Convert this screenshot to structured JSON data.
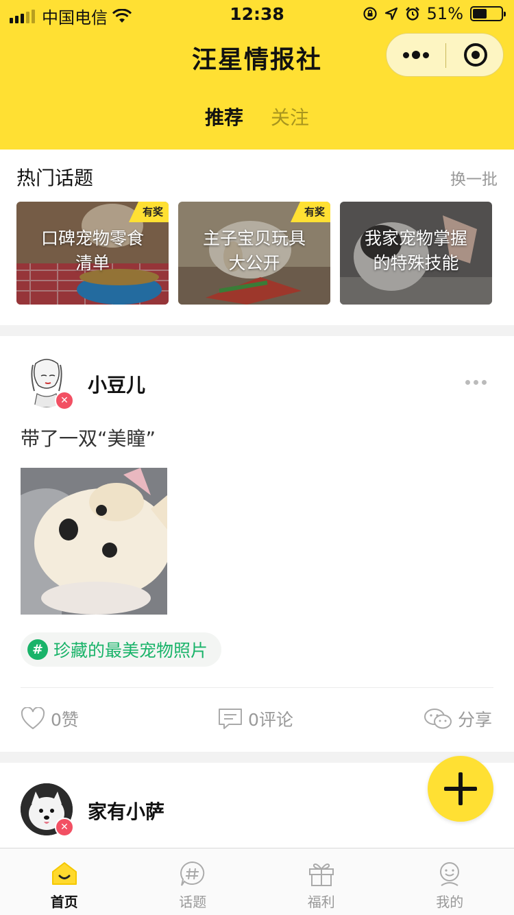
{
  "status_bar": {
    "carrier": "中国电信",
    "time": "12:38",
    "battery": "51%",
    "battery_level": 0.51
  },
  "header": {
    "title": "汪星情报社",
    "tabs": [
      {
        "label": "推荐",
        "active": true
      },
      {
        "label": "关注",
        "active": false
      }
    ]
  },
  "colors": {
    "brand_yellow": "#ffe033",
    "tag_green": "#19b369",
    "badge_red": "#f25063"
  },
  "hot_topics": {
    "title": "热门话题",
    "refresh": "换一批",
    "cards": [
      {
        "label_line1": "口碑宠物零食",
        "label_line2": "清单",
        "badge": "有奖"
      },
      {
        "label_line1": "主子宝贝玩具",
        "label_line2": "大公开",
        "badge": "有奖"
      },
      {
        "label_line1": "我家宠物掌握",
        "label_line2": "的特殊技能",
        "badge": ""
      }
    ]
  },
  "posts": [
    {
      "username": "小豆儿",
      "text": "带了一双“美瞳”",
      "tag": "珍藏的最美宠物照片",
      "tag_icon": "#",
      "likes": "0赞",
      "comments": "0评论",
      "share": "分享"
    },
    {
      "username": "家有小萨"
    }
  ],
  "bottom_nav": [
    {
      "label": "首页",
      "icon": "home-icon",
      "active": true
    },
    {
      "label": "话题",
      "icon": "topic-hash-icon",
      "active": false
    },
    {
      "label": "福利",
      "icon": "gift-icon",
      "active": false
    },
    {
      "label": "我的",
      "icon": "profile-icon",
      "active": false
    }
  ]
}
